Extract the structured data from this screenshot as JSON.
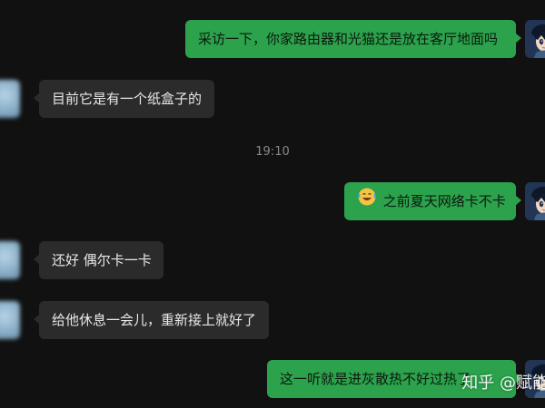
{
  "messages": [
    {
      "text": "采访一下，你家路由器和光猫还是放在客厅地面吗"
    },
    {
      "text": "目前它是有一个纸盒子的"
    },
    {
      "text": "之前夏天网络卡不卡"
    },
    {
      "text": "还好 偶尔卡一卡"
    },
    {
      "text": "给他休息一会儿，重新接上就好了"
    },
    {
      "text": "这一听就是进灰散热不好过热了"
    }
  ],
  "timestamp": "19:10",
  "watermark": "知乎 @赋能",
  "colors": {
    "background": "#111111",
    "outgoing_bubble": "#2ba24b",
    "incoming_bubble": "#2b2b2b"
  },
  "icons": {
    "emoji": "laughing-emoji-icon",
    "self_avatar": "anime-avatar-icon",
    "other_avatar": "blurred-avatar-icon"
  }
}
